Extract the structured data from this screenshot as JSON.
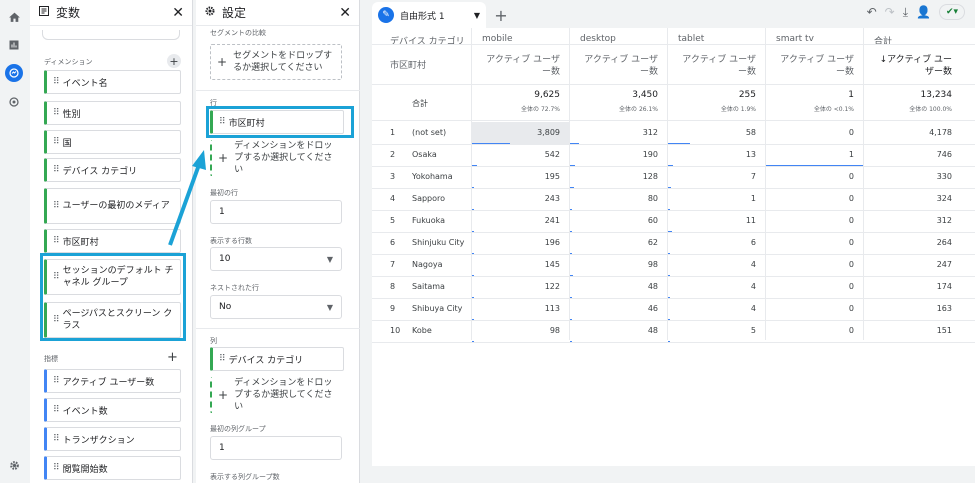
{
  "variables": {
    "title": "変数",
    "dimensions_label": "ディメンション",
    "dimensions": [
      "イベント名",
      "性別",
      "国",
      "デバイス カテゴリ",
      "ユーザーの最初のメディア",
      "市区町村",
      "セッションのデフォルト チャネル グループ",
      "ページパスとスクリーン クラス"
    ],
    "metrics_label": "指標",
    "metrics": [
      "アクティブ ユーザー数",
      "イベント数",
      "トランザクション",
      "閲覧開始数"
    ]
  },
  "settings": {
    "title": "設定",
    "segment_label": "セグメントの比較",
    "segment_drop": "セグメントをドロップするか選択してください",
    "rows_label": "行",
    "row_chip": "市区町村",
    "drop_dimension": "ディメンションをドロップするか選択してください",
    "first_row_label": "最初の行",
    "first_row_value": "1",
    "show_rows_label": "表示する行数",
    "show_rows_value": "10",
    "nested_rows_label": "ネストされた行",
    "nested_rows_value": "No",
    "columns_label": "列",
    "column_chip": "デバイス カテゴリ",
    "first_col_group_label": "最初の列グループ",
    "first_col_group_value": "1",
    "show_col_groups_label": "表示する列グループ数"
  },
  "tab": {
    "label": "自由形式 1"
  },
  "table": {
    "col_dim_label": "デバイス カテゴリ",
    "row_dim_label": "市区町村",
    "columns": [
      "mobile",
      "desktop",
      "tablet",
      "smart tv",
      "合計"
    ],
    "metric_label": "アクティブ ユーザー数",
    "metric_label_sorted": "↓アクティブ ユーザー数",
    "total_label": "合計",
    "totals": [
      "9,625",
      "3,450",
      "255",
      "1",
      "13,234"
    ],
    "total_pcts": [
      "全体の 72.7%",
      "全体の 26.1%",
      "全体の 1.9%",
      "全体の <0.1%",
      "全体の 100.0%"
    ],
    "rows": [
      {
        "n": "1",
        "city": "(not set)",
        "v": [
          "3,809",
          "312",
          "58",
          "0",
          "4,178"
        ]
      },
      {
        "n": "2",
        "city": "Osaka",
        "v": [
          "542",
          "190",
          "13",
          "1",
          "746"
        ]
      },
      {
        "n": "3",
        "city": "Yokohama",
        "v": [
          "195",
          "128",
          "7",
          "0",
          "330"
        ]
      },
      {
        "n": "4",
        "city": "Sapporo",
        "v": [
          "243",
          "80",
          "1",
          "0",
          "324"
        ]
      },
      {
        "n": "5",
        "city": "Fukuoka",
        "v": [
          "241",
          "60",
          "11",
          "0",
          "312"
        ]
      },
      {
        "n": "6",
        "city": "Shinjuku City",
        "v": [
          "196",
          "62",
          "6",
          "0",
          "264"
        ]
      },
      {
        "n": "7",
        "city": "Nagoya",
        "v": [
          "145",
          "98",
          "4",
          "0",
          "247"
        ]
      },
      {
        "n": "8",
        "city": "Saitama",
        "v": [
          "122",
          "48",
          "4",
          "0",
          "174"
        ]
      },
      {
        "n": "9",
        "city": "Shibuya City",
        "v": [
          "113",
          "46",
          "4",
          "0",
          "163"
        ]
      },
      {
        "n": "10",
        "city": "Kobe",
        "v": [
          "98",
          "48",
          "5",
          "0",
          "151"
        ]
      }
    ]
  },
  "colors": {
    "accent": "#1ba2d6",
    "dimension": "#34a853",
    "metric": "#4285f4",
    "brand": "#1a73e8"
  }
}
